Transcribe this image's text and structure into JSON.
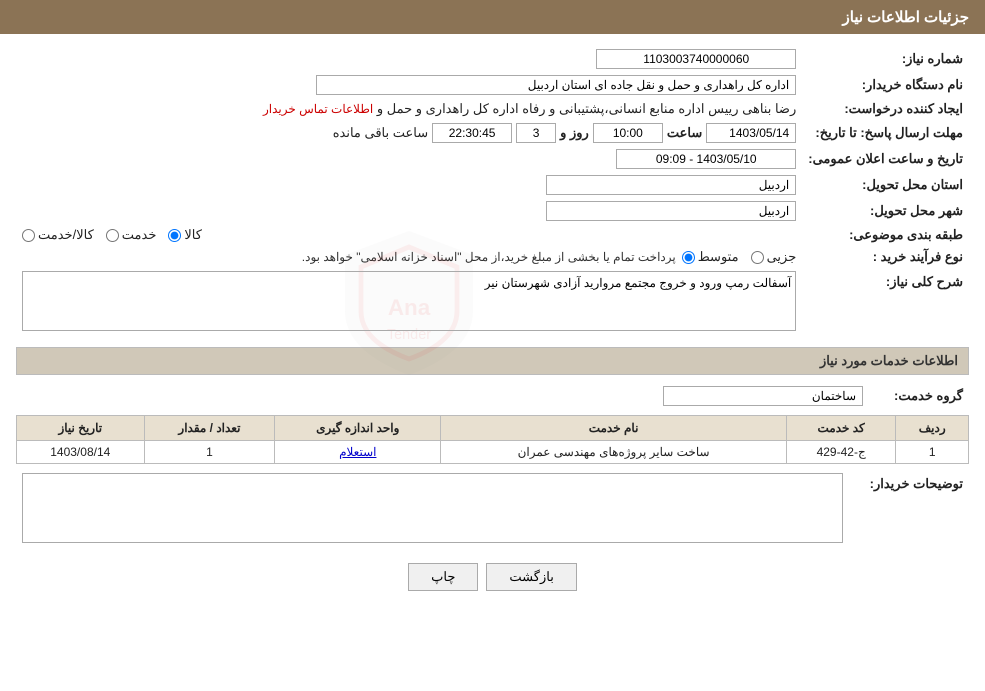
{
  "page": {
    "title": "جزئیات اطلاعات نیاز",
    "sections": {
      "header": "جزئیات اطلاعات نیاز",
      "services_header": "اطلاعات خدمات مورد نیاز"
    }
  },
  "fields": {
    "need_number_label": "شماره نیاز:",
    "need_number_value": "1103003740000060",
    "buyer_org_label": "نام دستگاه خریدار:",
    "buyer_org_value": "اداره کل راهداری و حمل و نقل جاده ای استان اردبیل",
    "creator_label": "ایجاد کننده درخواست:",
    "creator_value": "رضا بناهی رییس اداره منابع انسانی،پشتیبانی و رفاه اداره کل راهداری و حمل و",
    "contact_link": "اطلاعات تماس خریدار",
    "announcement_label": "تاریخ و ساعت اعلان عمومی:",
    "announcement_value": "1403/05/10 - 09:09",
    "deadline_label": "مهلت ارسال پاسخ: تا تاریخ:",
    "deadline_date": "1403/05/14",
    "deadline_time_label": "ساعت",
    "deadline_time": "10:00",
    "deadline_day_label": "روز و",
    "deadline_days": "3",
    "deadline_remaining_label": "ساعت باقی مانده",
    "deadline_remaining": "22:30:45",
    "province_label": "استان محل تحویل:",
    "province_value": "اردبیل",
    "city_label": "شهر محل تحویل:",
    "city_value": "اردبیل",
    "category_label": "طبقه بندی موضوعی:",
    "category_options": [
      "کالا",
      "خدمت",
      "کالا/خدمت"
    ],
    "category_selected": "کالا",
    "purchase_type_label": "نوع فرآیند خرید :",
    "purchase_type_options": [
      "جزیی",
      "متوسط"
    ],
    "purchase_type_selected": "متوسط",
    "purchase_note": "پرداخت تمام یا بخشی از مبلغ خرید،از محل \"اسناد خزانه اسلامی\" خواهد بود.",
    "need_description_label": "شرح کلی نیاز:",
    "need_description_value": "آسفالت رمپ ورود و خروج مجتمع مروارید آزادی شهرستان نیر",
    "service_group_label": "گروه خدمت:",
    "service_group_value": "ساختمان"
  },
  "services_table": {
    "columns": [
      "ردیف",
      "کد خدمت",
      "نام خدمت",
      "واحد اندازه گیری",
      "تعداد / مقدار",
      "تاریخ نیاز"
    ],
    "rows": [
      {
        "row": "1",
        "code": "ج-42-429",
        "name": "ساخت سایر پروژه‌های مهندسی عمران",
        "unit": "استعلام",
        "quantity": "1",
        "date": "1403/08/14"
      }
    ]
  },
  "buyer_description_label": "توضیحات خریدار:",
  "buttons": {
    "print": "چاپ",
    "back": "بازگشت"
  }
}
